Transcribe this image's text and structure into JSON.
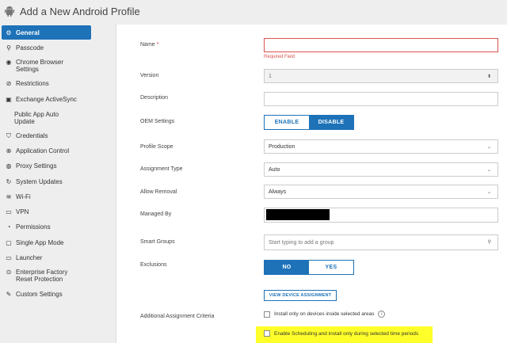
{
  "header": {
    "title": "Add a New Android Profile"
  },
  "sidebar": {
    "items": [
      {
        "label": "General",
        "icon": "gear-icon"
      },
      {
        "label": "Passcode",
        "icon": "key-icon"
      },
      {
        "label": "Chrome Browser Settings",
        "icon": "chrome-icon"
      },
      {
        "label": "Restrictions",
        "icon": "restrict-icon"
      },
      {
        "label": "Exchange ActiveSync",
        "icon": "exchange-icon"
      },
      {
        "label": "Public App Auto Update",
        "icon": ""
      },
      {
        "label": "Credentials",
        "icon": "shield-icon"
      },
      {
        "label": "Application Control",
        "icon": "x-circle-icon"
      },
      {
        "label": "Proxy Settings",
        "icon": "proxy-icon"
      },
      {
        "label": "System Updates",
        "icon": "refresh-icon"
      },
      {
        "label": "Wi-Fi",
        "icon": "wifi-icon"
      },
      {
        "label": "VPN",
        "icon": "vpn-icon"
      },
      {
        "label": "Permissions",
        "icon": "check-circle-icon"
      },
      {
        "label": "Single App Mode",
        "icon": "single-app-icon"
      },
      {
        "label": "Launcher",
        "icon": "launcher-icon"
      },
      {
        "label": "Enterprise Factory Reset Protection",
        "icon": "reset-icon"
      },
      {
        "label": "Custom Settings",
        "icon": "wrench-icon"
      }
    ]
  },
  "form": {
    "name_label": "Name",
    "required_mark": "*",
    "name_value": "",
    "required_msg": "Required Field",
    "version_label": "Version",
    "version_value": "1",
    "description_label": "Description",
    "oem_label": "OEM Settings",
    "oem_enable": "ENABLE",
    "oem_disable": "DISABLE",
    "scope_label": "Profile Scope",
    "scope_value": "Production",
    "assignment_label": "Assignment Type",
    "assignment_value": "Auto",
    "removal_label": "Allow Removal",
    "removal_value": "Always",
    "managed_label": "Managed By",
    "smart_label": "Smart Groups",
    "smart_placeholder": "Start typing to add a group",
    "exclusions_label": "Exclusions",
    "excl_no": "NO",
    "excl_yes": "YES",
    "view_btn": "VIEW DEVICE ASSIGNMENT",
    "criteria_label": "Additional Assignment Criteria",
    "chk_areas": "Install only on devices inside selected areas",
    "chk_schedule": "Enable Scheduling and install only during selected time periods"
  },
  "colors": {
    "accent": "#1d72b8",
    "highlight": "#ffff2a",
    "error": "#d9534f"
  }
}
